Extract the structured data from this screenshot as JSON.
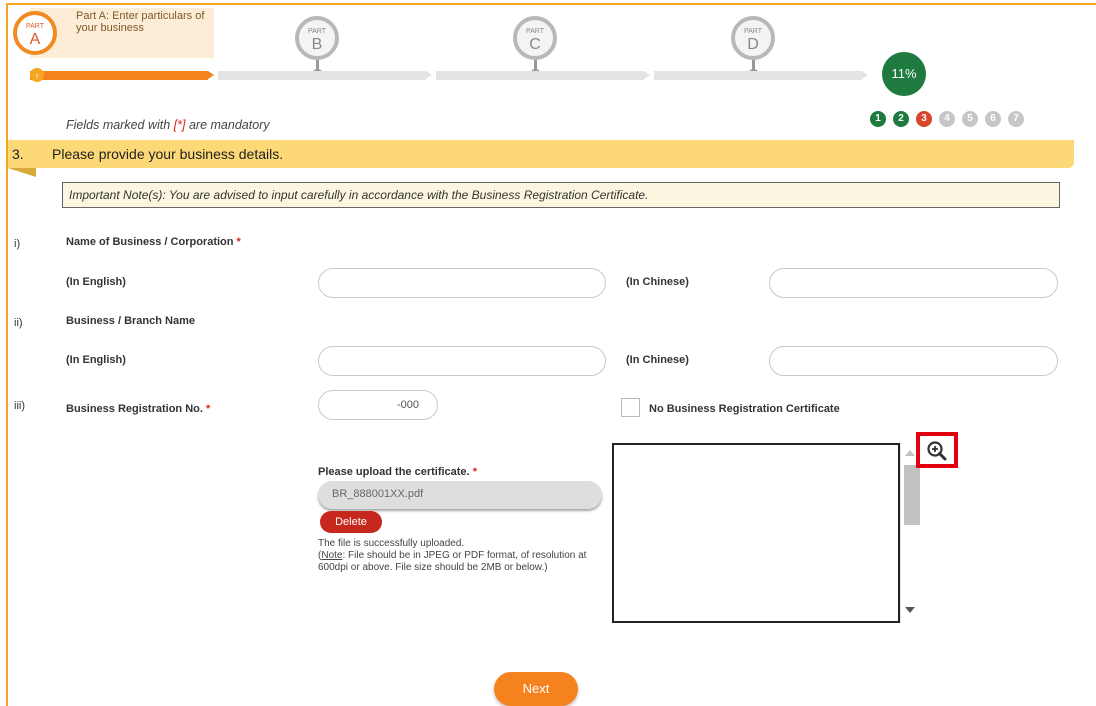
{
  "progress": {
    "part_a": {
      "label": "PART",
      "letter": "A",
      "description": "Part A: Enter particulars of your business"
    },
    "part_b": {
      "label": "PART",
      "letter": "B"
    },
    "part_c": {
      "label": "PART",
      "letter": "C"
    },
    "part_d": {
      "label": "PART",
      "letter": "D"
    },
    "percent_text": "11%",
    "percent_value": 0.11,
    "start_marker": "›"
  },
  "mandatory_note": {
    "prefix": "Fields marked with ",
    "marker": "[*]",
    "suffix": " are mandatory"
  },
  "steps": [
    {
      "num": "1",
      "status": "done"
    },
    {
      "num": "2",
      "status": "done"
    },
    {
      "num": "3",
      "status": "current"
    },
    {
      "num": "4",
      "status": "todo"
    },
    {
      "num": "5",
      "status": "todo"
    },
    {
      "num": "6",
      "status": "todo"
    },
    {
      "num": "7",
      "status": "todo"
    }
  ],
  "section": {
    "number": "3.",
    "title": "Please provide your business details."
  },
  "important_note": "Important Note(s): You are advised to input carefully in accordance with the Business Registration Certificate.",
  "form": {
    "item_i": {
      "roman": "i)",
      "label": "Name of Business / Corporation",
      "required": "*"
    },
    "item_i_english": {
      "label": "(In English)",
      "value": ""
    },
    "item_i_chinese": {
      "label": "(In Chinese)",
      "value": ""
    },
    "item_ii": {
      "roman": "ii)",
      "label": "Business / Branch Name"
    },
    "item_ii_english": {
      "label": "(In English)",
      "value": ""
    },
    "item_ii_chinese": {
      "label": "(In Chinese)",
      "value": ""
    },
    "item_iii": {
      "roman": "iii)",
      "label": "Business Registration No.",
      "required": "*",
      "value": "-000"
    },
    "no_brc_checkbox": {
      "label": "No Business Registration Certificate",
      "checked": false
    }
  },
  "upload": {
    "label": "Please upload the certificate.",
    "required": "*",
    "filename": "BR_888001XX.pdf",
    "delete_label": "Delete",
    "success_msg": "The file is successfully uploaded.",
    "note_label": "Note",
    "note_text": ": File should be in JPEG or PDF format, of resolution at 600dpi or above. File size should be 2MB or below.)",
    "note_open": "("
  },
  "preview": {
    "zoom_icon": "zoom-in-icon"
  },
  "next_label": "Next",
  "colors": {
    "accent_orange": "#f5821f",
    "done_green": "#1f7a3f",
    "current_red": "#d9442b",
    "section_yellow": "#fcd877",
    "highlight_red": "#e3000f"
  }
}
